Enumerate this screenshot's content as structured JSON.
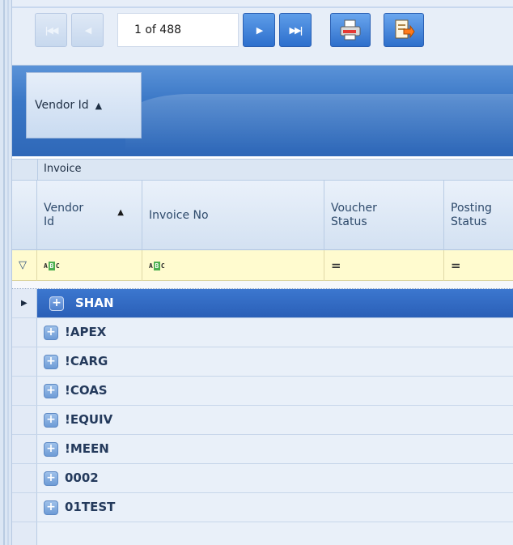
{
  "pager": {
    "page_text": "1 of 488",
    "buttons": [
      "first-page",
      "previous-page",
      "next-page",
      "last-page",
      "print",
      "export"
    ]
  },
  "group_panel": {
    "chip_label": "Vendor Id",
    "chip_sort_icon": "sort-ascending-icon"
  },
  "band": {
    "label": "Invoice"
  },
  "columns": [
    {
      "label": "Vendor Id",
      "sorted": "asc",
      "filter_icon": "abc-filter-icon"
    },
    {
      "label": "Invoice No",
      "filter_icon": "abc-filter-icon"
    },
    {
      "label": "Voucher Status",
      "filter_icon": "equals-filter-icon"
    },
    {
      "label": "Posting Status",
      "filter_icon": "equals-filter-icon"
    }
  ],
  "filter_row": {
    "abc_text": "ABC",
    "equals_symbol": "="
  },
  "groups": [
    {
      "label": "SHAN",
      "selected": true
    },
    {
      "label": "!APEX",
      "selected": false
    },
    {
      "label": "!CARG",
      "selected": false
    },
    {
      "label": "!COAS",
      "selected": false
    },
    {
      "label": "!EQUIV",
      "selected": false
    },
    {
      "label": "!MEEN",
      "selected": false
    },
    {
      "label": "0002",
      "selected": false
    },
    {
      "label": "01TEST",
      "selected": false
    }
  ],
  "colors": {
    "selected_row": "#2f67c0",
    "header_band": "#3a77c6",
    "filter_row": "#fffbcf"
  }
}
